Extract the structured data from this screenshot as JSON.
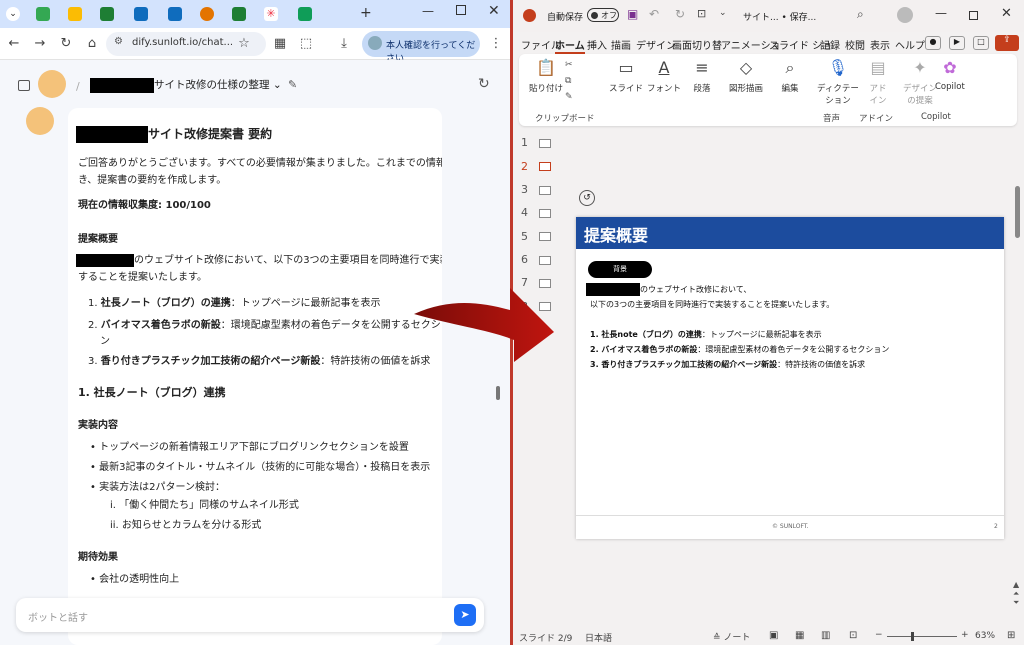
{
  "browser": {
    "address": "dify.sunloft.io/chat...",
    "identity_button": "本人確認を行ってください"
  },
  "chat": {
    "header_title": "サイト改修の仕様の整理",
    "message": {
      "title": "サイト改修提案書 要約",
      "intro1": "ご回答ありがとうございます。すべての必要情報が集まりました。これまでの情報に基づ",
      "intro2": "き、提案書の要約を作成します。",
      "progress": "現在の情報収集度: 100/100",
      "section1": "提案概要",
      "overview1": "のウェブサイト改修において、以下の3つの主要項目を同時進行で実装",
      "overview2": "することを提案いたします。",
      "items": [
        {
          "num": "1.",
          "bold": "社長ノート（ブログ）の連携",
          "text": "：トップページに最新記事を表示"
        },
        {
          "num": "2.",
          "bold": "バイオマス着色ラボの新設",
          "text": "：環境配慮型素材の着色データを公開するセクショ"
        },
        {
          "num": "3.",
          "bold": "香り付きプラスチック加工技術の紹介ページ新設",
          "text": "：特許技術の価値を訴求"
        }
      ],
      "item2_cont": "ン",
      "section2": "1. 社長ノート（ブログ）連携",
      "impl_title": "実装内容",
      "bullets": [
        "トップページの新着情報エリア下部にブログリンクセクションを設置",
        "最新3記事のタイトル・サムネイル（技術的に可能な場合）・投稿日を表示",
        "実装方法は2パターン検討："
      ],
      "sub1": "i. 「働く仲間たち」同様のサムネイル形式",
      "sub2": "ii. お知らせとカラムを分ける形式",
      "effect_title": "期待効果",
      "effect1": "会社の透明性向上"
    },
    "input_placeholder": "ボットと話す"
  },
  "ppt": {
    "autosave": "自動保存",
    "autosave_state": "オフ",
    "doc_title": "サイト... • 保存...",
    "menu": [
      "ファイル",
      "ホーム",
      "挿入",
      "描画",
      "デザイン",
      "画面切り替",
      "アニメーショ",
      "スライド ショ",
      "記録",
      "校閲",
      "表示",
      "ヘルプ"
    ],
    "ribbon": {
      "paste": "貼り付け",
      "clipboard": "クリップボード",
      "slide": "スライド",
      "font": "フォント",
      "paragraph": "段落",
      "drawing": "図形描画",
      "edit": "編集",
      "dictate": "ディクテー\nション",
      "addin": "アド\nイン",
      "design_proposal": "デザイン\nの提案",
      "copilot": "Copilot",
      "group_voice": "音声",
      "group_addin": "アドイン",
      "group_copilot": "Copilot"
    },
    "thumb_numbers": [
      "1",
      "2",
      "3",
      "4",
      "5",
      "6",
      "7",
      "8"
    ],
    "slide": {
      "title": "提案概要",
      "badge": "背景",
      "line1": "のウェブサイト改修において、",
      "line2": "以下の3つの主要項目を同時進行で実装することを提案いたします。",
      "items": [
        {
          "bold": "1. 社長note（ブログ）の連携",
          "text": "：トップページに最新記事を表示"
        },
        {
          "bold": "2. バイオマス着色ラボの新設",
          "text": "：環境配慮型素材の着色データを公開するセクション"
        },
        {
          "bold": "3. 香り付きプラスチック加工技術の紹介ページ新設",
          "text": "：特許技術の価値を訴求"
        }
      ],
      "footer": "© SUNLOFT.",
      "page": "2"
    },
    "status": {
      "slide_count": "スライド 2/9",
      "language": "日本語",
      "notes": "ノート",
      "zoom": "63%"
    },
    "colors": {
      "accent": "#1c4c9e",
      "arrow": "#c0150f"
    }
  }
}
